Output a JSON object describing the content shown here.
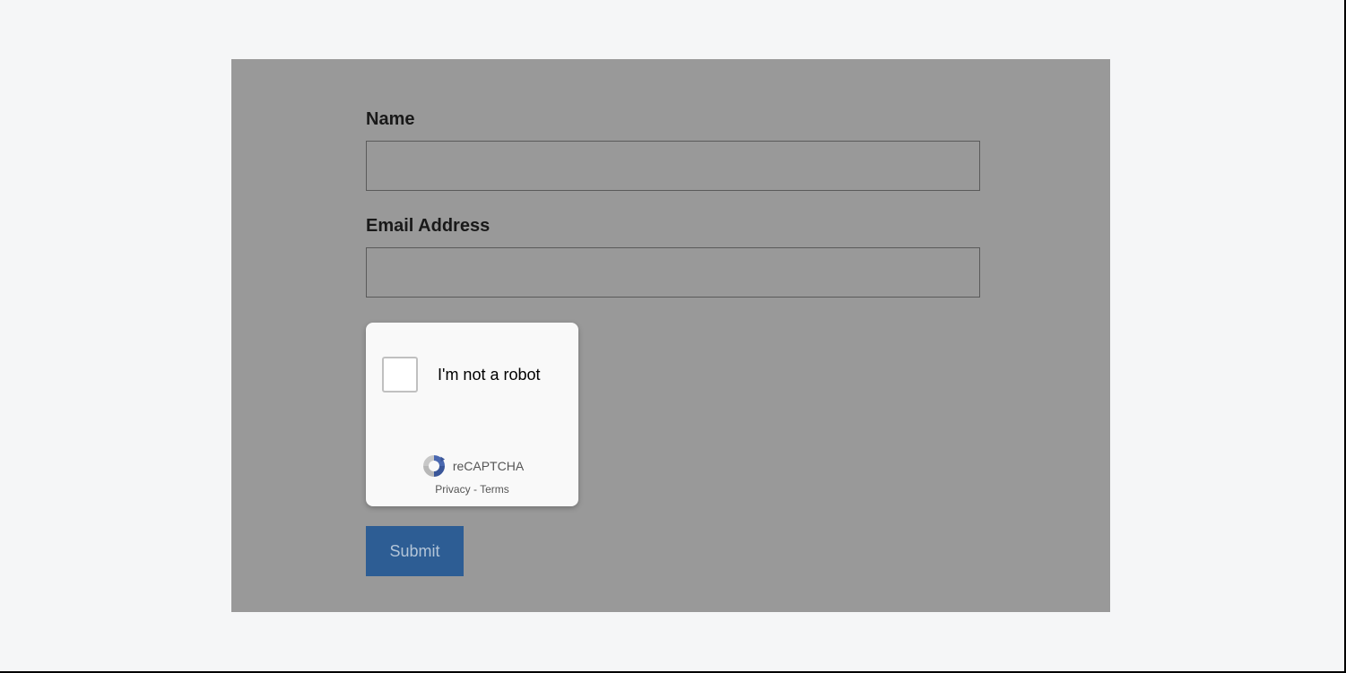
{
  "form": {
    "name_label": "Name",
    "name_value": "",
    "email_label": "Email Address",
    "email_value": "",
    "submit_label": "Submit"
  },
  "recaptcha": {
    "label": "I'm not a robot",
    "brand": "reCAPTCHA",
    "privacy": "Privacy",
    "separator": " - ",
    "terms": "Terms"
  }
}
